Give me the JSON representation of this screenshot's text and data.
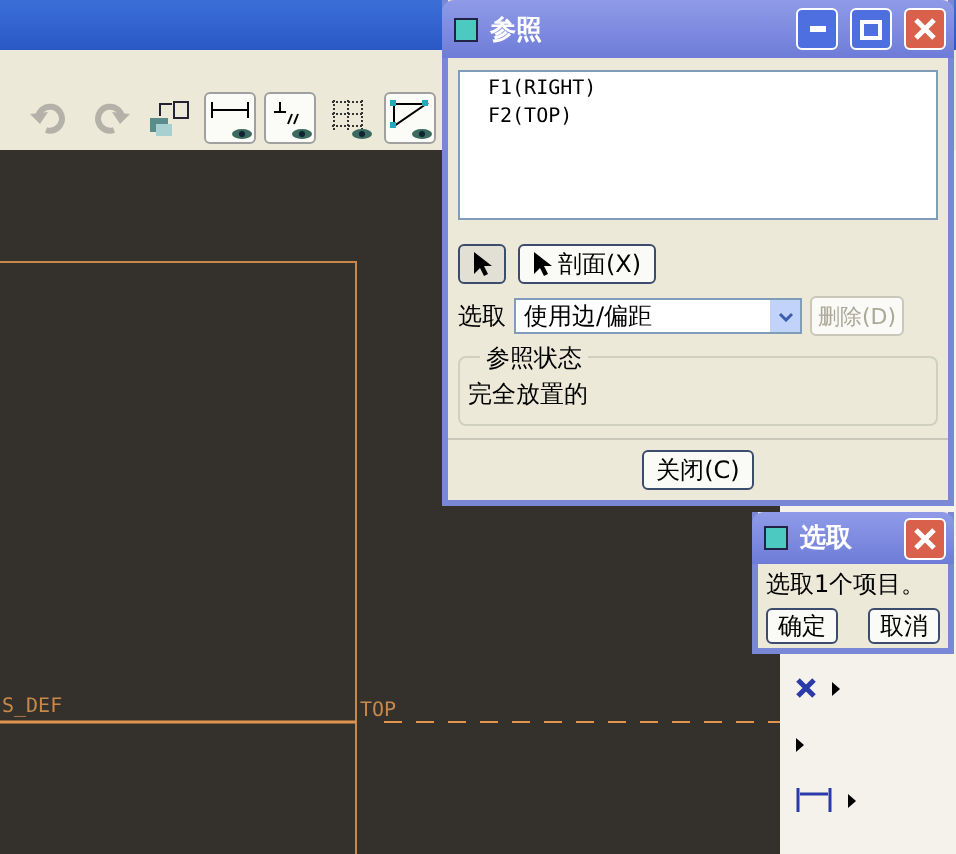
{
  "toolbar": [
    {
      "kind": "undo",
      "disabled": true
    },
    {
      "kind": "redo",
      "disabled": true
    },
    {
      "kind": "regenerate"
    },
    {
      "kind": "dimension-display",
      "selected": true
    },
    {
      "kind": "constraint-display",
      "selected": true
    },
    {
      "kind": "grid-display",
      "selected": false
    },
    {
      "kind": "vertex-display",
      "selected": true
    }
  ],
  "canvas": {
    "labels": [
      "S_DEF",
      "TOP"
    ]
  },
  "side_toolbar": [
    {
      "kind": "point"
    },
    {
      "kind": "blank"
    },
    {
      "kind": "dimension"
    }
  ],
  "references_dialog": {
    "title": "参照",
    "references": [
      "F1(RIGHT)",
      "F2(TOP)"
    ],
    "pick_button": {
      "selected": true
    },
    "section_button": "剖面(X)",
    "select_label": "选取",
    "select_value": "使用边/偏距",
    "delete_button": {
      "label": "删除(D)",
      "disabled": true
    },
    "status_group": {
      "title": "参照状态",
      "text": "完全放置的"
    },
    "close_button": "关闭(C)"
  },
  "select_dialog": {
    "title": "选取",
    "message": "选取1个项目。",
    "buttons": [
      "确定",
      "取消"
    ]
  }
}
